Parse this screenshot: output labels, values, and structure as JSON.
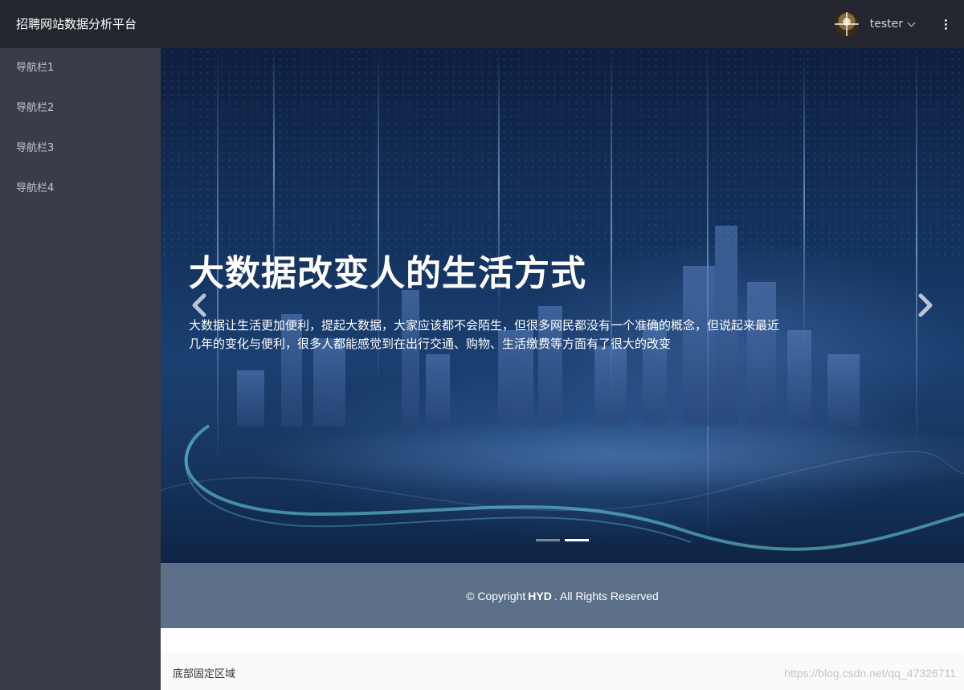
{
  "sidebar": {
    "brand": "招聘网站数据分析平台",
    "items": [
      {
        "label": "导航栏1"
      },
      {
        "label": "导航栏2"
      },
      {
        "label": "导航栏3"
      },
      {
        "label": "导航栏4"
      }
    ]
  },
  "header": {
    "username": "tester",
    "icons": {
      "avatar": "user-avatar",
      "dropdown": "chevron-down-icon",
      "more": "more-vertical-icon"
    }
  },
  "carousel": {
    "title": "大数据改变人的生活方式",
    "text": "大数据让生活更加便利，提起大数据，大家应该都不会陌生，但很多网民都没有一个准确的概念，但说起来最近几年的变化与便利，很多人都能感觉到在出行交通、购物、生活缴费等方面有了很大的改变",
    "indicators": 2,
    "active_index": 1,
    "icons": {
      "prev": "chevron-left-icon",
      "next": "chevron-right-icon"
    }
  },
  "copyright": {
    "prefix": "© Copyright",
    "owner": "HYD",
    "suffix": ". All Rights Reserved"
  },
  "footer": {
    "text": "底部固定区域",
    "watermark": "https://blog.csdn.net/qq_47326711"
  },
  "colors": {
    "sidebar_bg": "#393d49",
    "header_bg": "#23262e",
    "copyright_bg": "#5b7088",
    "footer_bg": "#fafafa"
  }
}
